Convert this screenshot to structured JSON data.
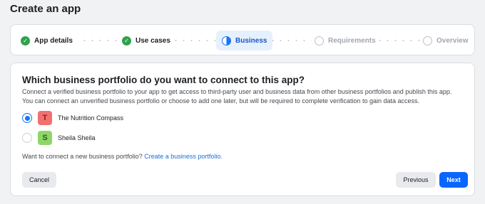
{
  "page": {
    "title": "Create an app"
  },
  "stepper": {
    "steps": [
      {
        "label": "App details",
        "state": "complete"
      },
      {
        "label": "Use cases",
        "state": "complete"
      },
      {
        "label": "Business",
        "state": "active"
      },
      {
        "label": "Requirements",
        "state": "pending"
      },
      {
        "label": "Overview",
        "state": "pending"
      }
    ]
  },
  "main": {
    "question": "Which business portfolio do you want to connect to this app?",
    "description_line1": "Connect a verified business portfolio to your app to get access to third-party user and business data from other business portfolios and publish this app.",
    "description_line2": "You can connect an unverified business portfolio or choose to add one later, but will be required to complete verification to gain data access.",
    "options": [
      {
        "initial": "T",
        "name": "The Nutrition Compass",
        "selected": true,
        "avatar_bg": "#f2706f",
        "avatar_fg": "#8c1f1f"
      },
      {
        "initial": "S",
        "name": "Sheila Sheila",
        "selected": false,
        "avatar_bg": "#8fd66a",
        "avatar_fg": "#2b5a16"
      }
    ],
    "helper_text": "Want to connect a new business portfolio?",
    "helper_link": "Create a business portfolio."
  },
  "buttons": {
    "cancel": "Cancel",
    "previous": "Previous",
    "next": "Next"
  },
  "colors": {
    "accent": "#1877f2",
    "success": "#31a24c",
    "primary_button": "#0866ff"
  }
}
